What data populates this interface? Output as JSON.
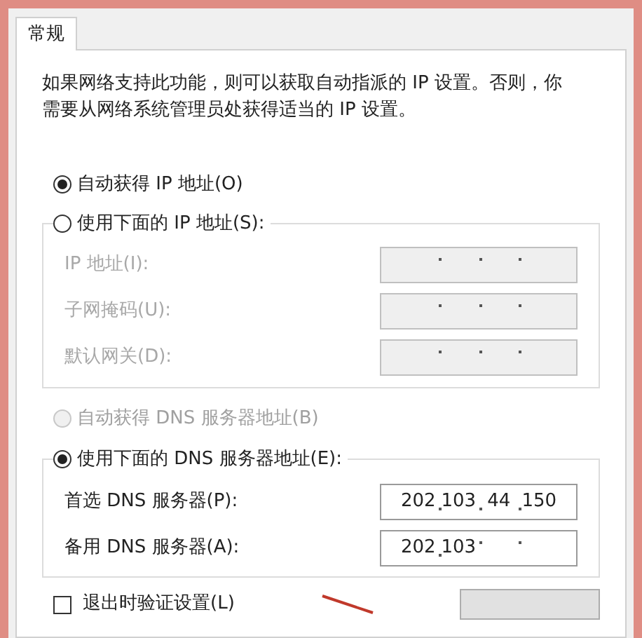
{
  "tabs": [
    {
      "label": "常规",
      "selected": true
    }
  ],
  "description": "如果网络支持此功能，则可以获取自动指派的 IP 设置。否则，你需要从网络系统管理员处获得适当的 IP 设置。",
  "ip_mode": [
    {
      "label": "自动获得 IP 地址(O)",
      "selected": true,
      "disabled": false
    },
    {
      "label": "使用下面的 IP 地址(S):",
      "selected": false,
      "disabled": false
    }
  ],
  "ip_fields": [
    {
      "label": "IP 地址(I):",
      "disabled": true
    },
    {
      "label": "子网掩码(U):",
      "disabled": true
    },
    {
      "label": "默认网关(D):",
      "disabled": true
    }
  ],
  "dns_mode": [
    {
      "label": "自动获得 DNS 服务器地址(B)",
      "selected": false,
      "disabled": true
    },
    {
      "label": "使用下面的 DNS 服务器地址(E):",
      "selected": true,
      "disabled": false
    }
  ],
  "dns_fields": [
    {
      "label": "首选 DNS 服务器(P):",
      "octets": [
        "202",
        "103",
        "44",
        "150"
      ],
      "disabled": false
    },
    {
      "label": "备用 DNS 服务器(A):",
      "octets": [
        "202",
        "103"
      ],
      "disabled": false
    }
  ],
  "validate_on_exit": {
    "label": "退出时验证设置(L)",
    "checked": false
  }
}
